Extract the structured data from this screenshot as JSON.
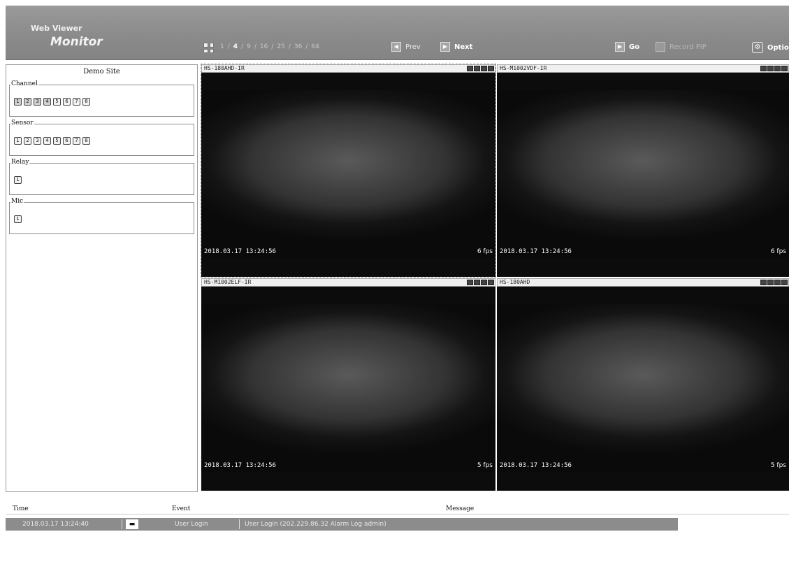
{
  "header": {
    "brand_small": "Web Viewer",
    "brand_big": "Monitor",
    "split_options": [
      "1",
      "4",
      "9",
      "16",
      "25",
      "36",
      "64"
    ],
    "split_separator": "/",
    "active_split": "4",
    "prev_label": "Prev",
    "next_label": "Next",
    "go_label": "Go",
    "record_label": "Record PIP",
    "option_label": "Optio"
  },
  "sidebar": {
    "site_name": "Demo Site",
    "groups": [
      {
        "label": "Channel",
        "buttons": [
          "1",
          "2",
          "3",
          "4",
          "5",
          "6",
          "7",
          "8"
        ]
      },
      {
        "label": "Sensor",
        "buttons": [
          "1",
          "2",
          "3",
          "4",
          "5",
          "6",
          "7",
          "8"
        ]
      },
      {
        "label": "Relay",
        "buttons": [
          "1"
        ]
      },
      {
        "label": "Mic",
        "buttons": [
          "1"
        ]
      }
    ]
  },
  "cameras": [
    {
      "name": "HS-180AHD-IR",
      "timestamp": "2018.03.17 13:24:56",
      "fps": "6 fps"
    },
    {
      "name": "HS-M1002VDF-IR",
      "timestamp": "2018.03.17 13:24:56",
      "fps": "6 fps"
    },
    {
      "name": "HS-M1002ELF-IR",
      "timestamp": "2018.03.17 13:24:56",
      "fps": "5 fps"
    },
    {
      "name": "HS-180AHD",
      "timestamp": "2018.03.17 13:24:56",
      "fps": "5 fps"
    }
  ],
  "event_log": {
    "columns": [
      "Time",
      "Event",
      "Message"
    ],
    "rows": [
      {
        "time": "2018.03.17 13:24:40",
        "event": "User Login",
        "message": "User Login (202.229.86.32 Alarm Log admin)"
      }
    ]
  },
  "colors": {
    "header_bg": "#8f8f8f",
    "selected_row": "#8c8c8c",
    "video_bg": "#0c0c0c"
  }
}
